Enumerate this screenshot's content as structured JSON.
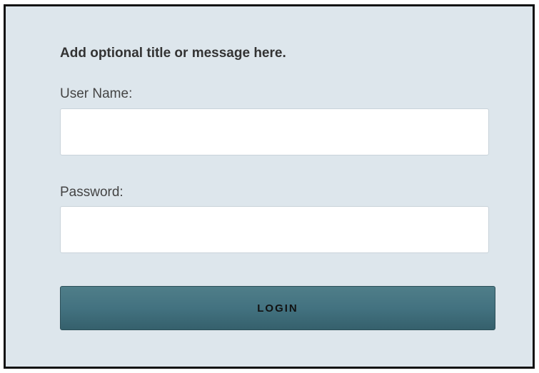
{
  "login_form": {
    "title": "Add optional title or message here.",
    "username_label": "User Name:",
    "username_value": "",
    "password_label": "Password:",
    "password_value": "",
    "login_button_label": "LOGIN"
  },
  "colors": {
    "panel_background": "#dde6ec",
    "panel_border": "#111111",
    "button_background": "#437280",
    "field_background": "#ffffff"
  }
}
